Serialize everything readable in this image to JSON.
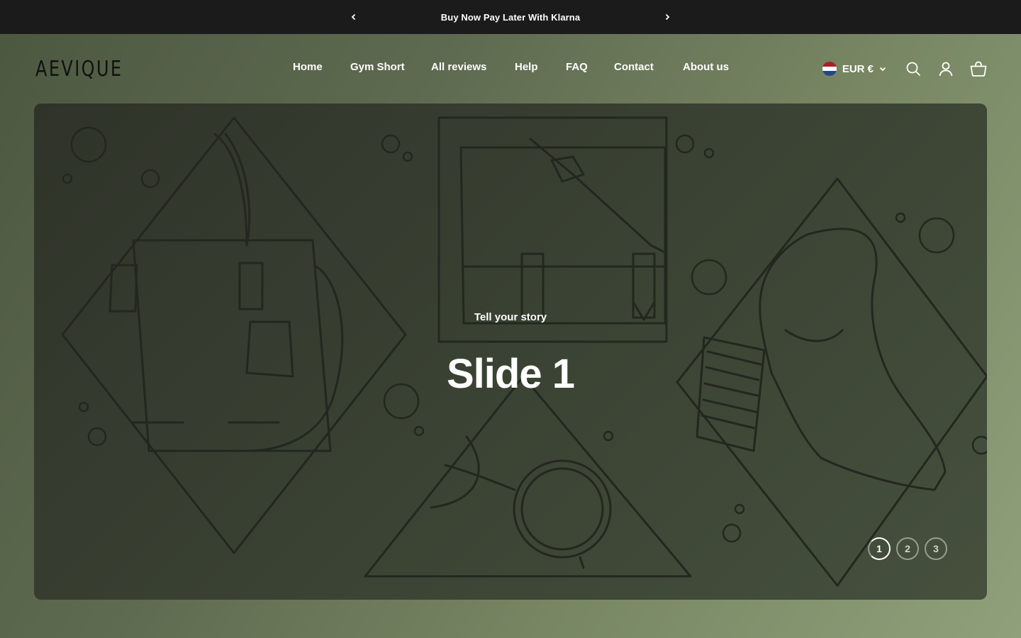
{
  "announcement": {
    "text": "Buy Now Pay Later With Klarna",
    "prev_icon": "chevron-left-icon",
    "next_icon": "chevron-right-icon"
  },
  "header": {
    "logo": "AEVIQUE",
    "nav": [
      {
        "label": "Home"
      },
      {
        "label": "Gym Short"
      },
      {
        "label": "All reviews"
      },
      {
        "label": "Help"
      },
      {
        "label": "FAQ"
      },
      {
        "label": "Contact"
      },
      {
        "label": "About us"
      }
    ],
    "currency": "EUR €",
    "icons": [
      "search-icon",
      "account-icon",
      "cart-icon"
    ]
  },
  "hero": {
    "subtitle": "Tell your story",
    "title": "Slide 1",
    "slides": [
      "1",
      "2",
      "3"
    ],
    "active_slide": "1"
  },
  "colors": {
    "announcement_bg": "#1b1b1b",
    "page_bg": "#6b7a5a",
    "hero_bg": "#373d30",
    "line_art": "#22261e",
    "text": "#ffffff"
  }
}
